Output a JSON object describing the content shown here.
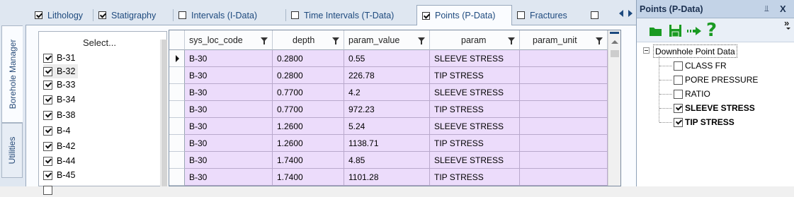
{
  "side_tabs": [
    {
      "label": "Borehole Manager",
      "active": true
    },
    {
      "label": "Utilities",
      "active": false
    }
  ],
  "tabs": [
    {
      "label": "Lithology",
      "checked": true
    },
    {
      "label": "Statigraphy",
      "checked": true
    },
    {
      "label": "Intervals (I-Data)",
      "checked": false
    },
    {
      "label": "Time Intervals (T-Data)",
      "checked": false
    },
    {
      "label": "Points (P-Data)",
      "checked": true,
      "active": true
    },
    {
      "label": "Fractures",
      "checked": false
    }
  ],
  "select_list": {
    "header": "Select...",
    "items": [
      {
        "label": "B-31",
        "checked": true
      },
      {
        "label": "B-32",
        "checked": true,
        "selected": true
      },
      {
        "label": "B-33",
        "checked": true
      },
      {
        "label": "B-34",
        "checked": true
      },
      {
        "label": "B-38",
        "checked": true
      },
      {
        "label": "B-4",
        "checked": true
      },
      {
        "label": "B-42",
        "checked": true
      },
      {
        "label": "B-44",
        "checked": true
      },
      {
        "label": "B-45",
        "checked": true
      }
    ]
  },
  "grid": {
    "columns": [
      "sys_loc_code",
      "depth",
      "param_value",
      "param",
      "param_unit"
    ],
    "rows": [
      [
        "B-30",
        "0.2800",
        "0.55",
        "SLEEVE STRESS",
        ""
      ],
      [
        "B-30",
        "0.2800",
        "226.78",
        "TIP STRESS",
        ""
      ],
      [
        "B-30",
        "0.7700",
        "4.2",
        "SLEEVE STRESS",
        ""
      ],
      [
        "B-30",
        "0.7700",
        "972.23",
        "TIP STRESS",
        ""
      ],
      [
        "B-30",
        "1.2600",
        "5.24",
        "SLEEVE STRESS",
        ""
      ],
      [
        "B-30",
        "1.2600",
        "1138.71",
        "TIP STRESS",
        ""
      ],
      [
        "B-30",
        "1.7400",
        "4.85",
        "SLEEVE STRESS",
        ""
      ],
      [
        "B-30",
        "1.7400",
        "1101.28",
        "TIP STRESS",
        ""
      ]
    ],
    "row_color": "#ecdcfb"
  },
  "right_panel": {
    "title": "Points (P-Data)",
    "pin_glyph": "\u0004",
    "close_glyph": "X",
    "toolbar_icons": [
      "folder-open-icon",
      "save-icon",
      "import-arrow-icon",
      "help-icon"
    ],
    "overflow_glyph": "»",
    "tree": {
      "root": "Downhole Point Data",
      "items": [
        {
          "label": "CLASS FR",
          "checked": false
        },
        {
          "label": "PORE PRESSURE",
          "checked": false
        },
        {
          "label": "RATIO",
          "checked": false
        },
        {
          "label": "SLEEVE STRESS",
          "checked": true
        },
        {
          "label": "TIP STRESS",
          "checked": true
        }
      ]
    }
  },
  "colors": {
    "accent": "#1e4a7e",
    "icon_green": "#1a9a22"
  }
}
